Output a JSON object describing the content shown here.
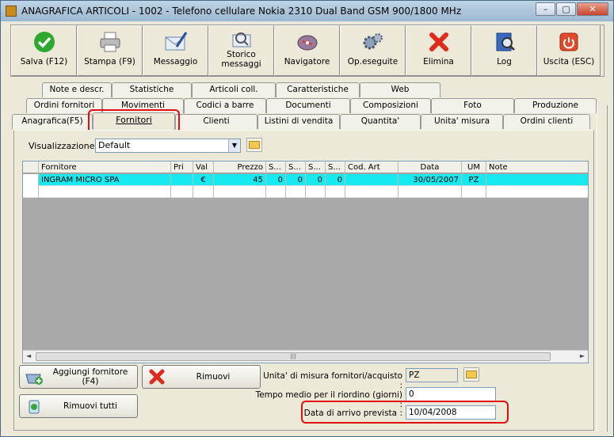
{
  "window": {
    "title": "ANAGRAFICA ARTICOLI - 1002 - Telefono cellulare Nokia 2310 Dual Band GSM 900/1800 MHz",
    "min": "–",
    "max": "▢",
    "close": "✕"
  },
  "toolbar": [
    {
      "label": "Salva (F12)",
      "icon": "check-icon"
    },
    {
      "label": "Stampa (F9)",
      "icon": "printer-icon"
    },
    {
      "label": "Messaggio",
      "icon": "mail-pen-icon"
    },
    {
      "label": "Storico messaggi",
      "icon": "mail-search-icon"
    },
    {
      "label": "Navigatore",
      "icon": "compass-icon"
    },
    {
      "label": "Op.eseguite",
      "icon": "gears-icon"
    },
    {
      "label": "Elimina",
      "icon": "x-icon"
    },
    {
      "label": "Log",
      "icon": "log-book-icon"
    },
    {
      "label": "Uscita (ESC)",
      "icon": "power-icon"
    }
  ],
  "tabs": {
    "row1": [
      "Note e descr.",
      "Statistiche",
      "Articoli coll.",
      "Caratteristiche",
      "Web"
    ],
    "row2": [
      "Ordini fornitori",
      "Movimenti",
      "Codici a barre",
      "Documenti",
      "Composizioni",
      "Foto",
      "Produzione"
    ],
    "row3": [
      "Anagrafica(F5)",
      "Fornitori",
      "Clienti",
      "Listini di vendita",
      "Quantita'",
      "Unita' misura",
      "Ordini clienti"
    ]
  },
  "visualizzazione": {
    "label": "Visualizzazione :",
    "value": "Default"
  },
  "grid": {
    "columns": [
      "Fornitore",
      "Pri",
      "Val",
      "Prezzo",
      "S...",
      "S...",
      "S...",
      "S...",
      "Cod. Art",
      "Data",
      "UM",
      "Note"
    ],
    "rows": [
      [
        "INGRAM MICRO SPA",
        "",
        "€",
        "45",
        "0",
        "0",
        "0",
        "0",
        "",
        "30/05/2007",
        "PZ",
        ""
      ]
    ]
  },
  "buttons": {
    "add": "Aggiungi fornitore (F4)",
    "remove": "Rimuovi",
    "remove_all": "Rimuovi tutti"
  },
  "fields": {
    "um_label": "Unita' di misura fornitori/acquisto :",
    "um_value": "PZ",
    "tempo_label": "Tempo medio per il riordino (giorni) :",
    "tempo_value": "0",
    "data_label": "Data di arrivo prevista :",
    "data_value": "10/04/2008"
  },
  "colors": {
    "selected_row": "#16e9f0",
    "highlight": "#e01010"
  }
}
